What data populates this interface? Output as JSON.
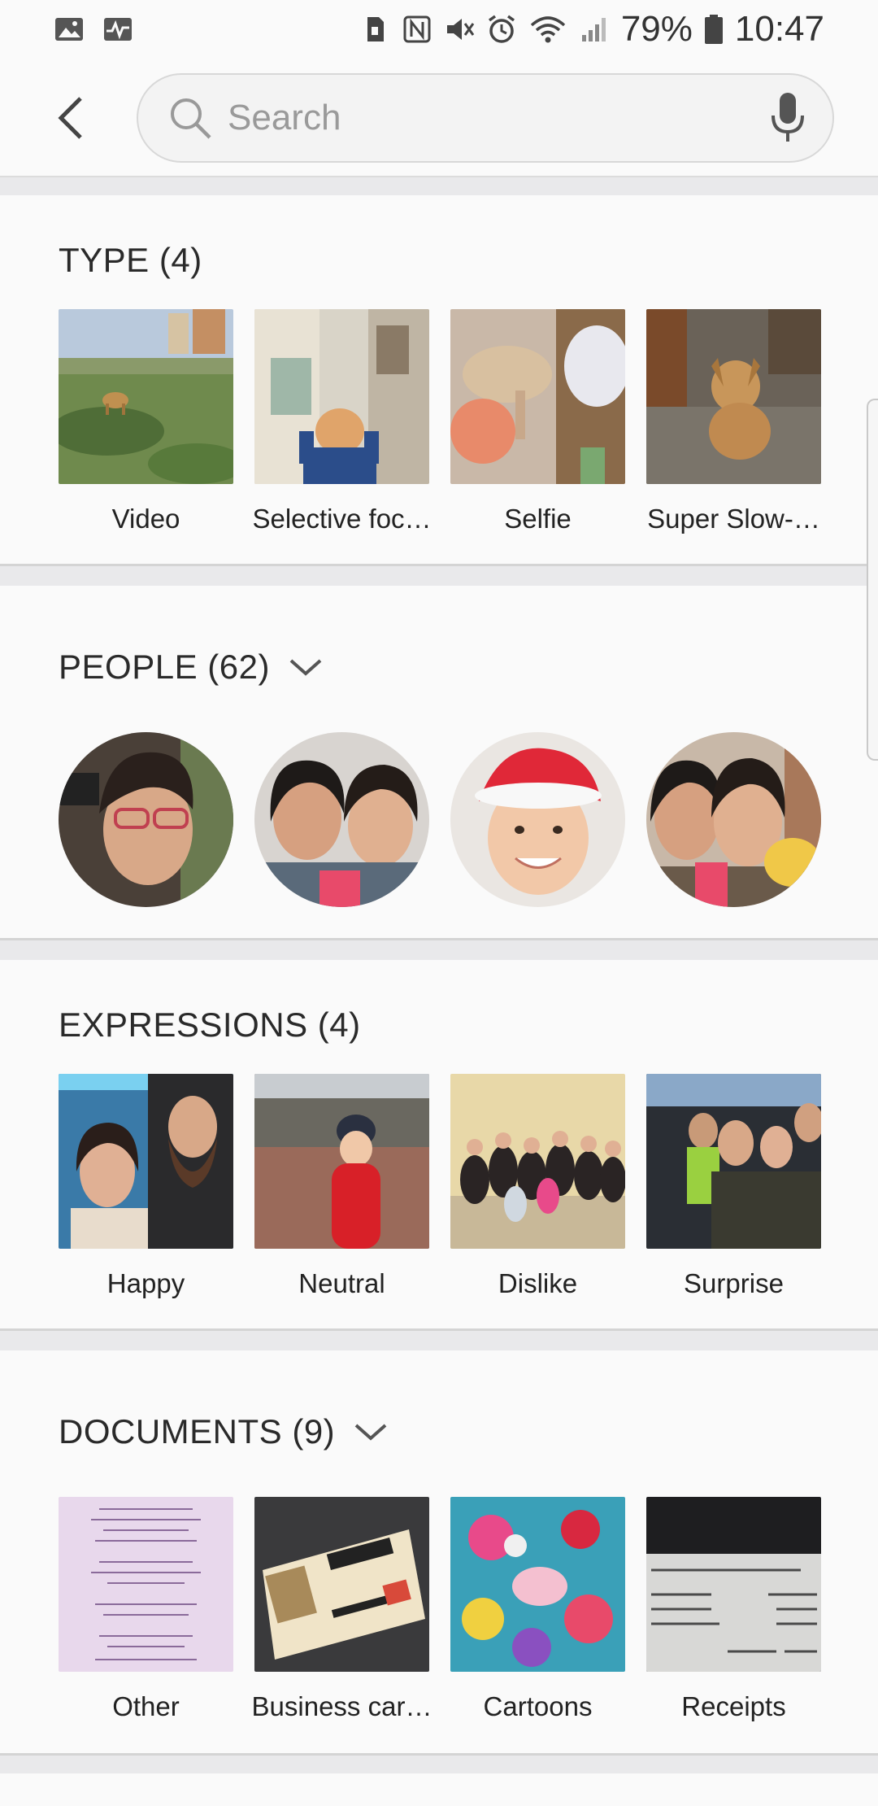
{
  "status_bar": {
    "battery": "79%",
    "time": "10:47",
    "left_icons": [
      "gallery-icon",
      "activity-icon"
    ],
    "right_icons": [
      "sim-icon",
      "nfc-icon",
      "mute-icon",
      "alarm-icon",
      "wifi-icon",
      "signal-icon",
      "battery-icon"
    ]
  },
  "search": {
    "placeholder": "Search"
  },
  "sections": {
    "type": {
      "title": "TYPE (4)",
      "items": [
        {
          "label": "Video",
          "icon": "video-thumbnail"
        },
        {
          "label": "Selective foc…",
          "icon": "selective-focus-thumbnail"
        },
        {
          "label": "Selfie",
          "icon": "selfie-thumbnail"
        },
        {
          "label": "Super Slow-…",
          "icon": "super-slow-thumbnail"
        }
      ]
    },
    "people": {
      "title": "PEOPLE (62)"
    },
    "expressions": {
      "title": "EXPRESSIONS (4)",
      "items": [
        {
          "label": "Happy"
        },
        {
          "label": "Neutral"
        },
        {
          "label": "Dislike"
        },
        {
          "label": "Surprise"
        }
      ]
    },
    "documents": {
      "title": "DOCUMENTS (9)",
      "items": [
        {
          "label": "Other"
        },
        {
          "label": "Business car…"
        },
        {
          "label": "Cartoons"
        },
        {
          "label": "Receipts"
        }
      ]
    }
  },
  "colors": {
    "background": "#fafafa",
    "divider": "#e9e9eb",
    "text": "#222222"
  }
}
